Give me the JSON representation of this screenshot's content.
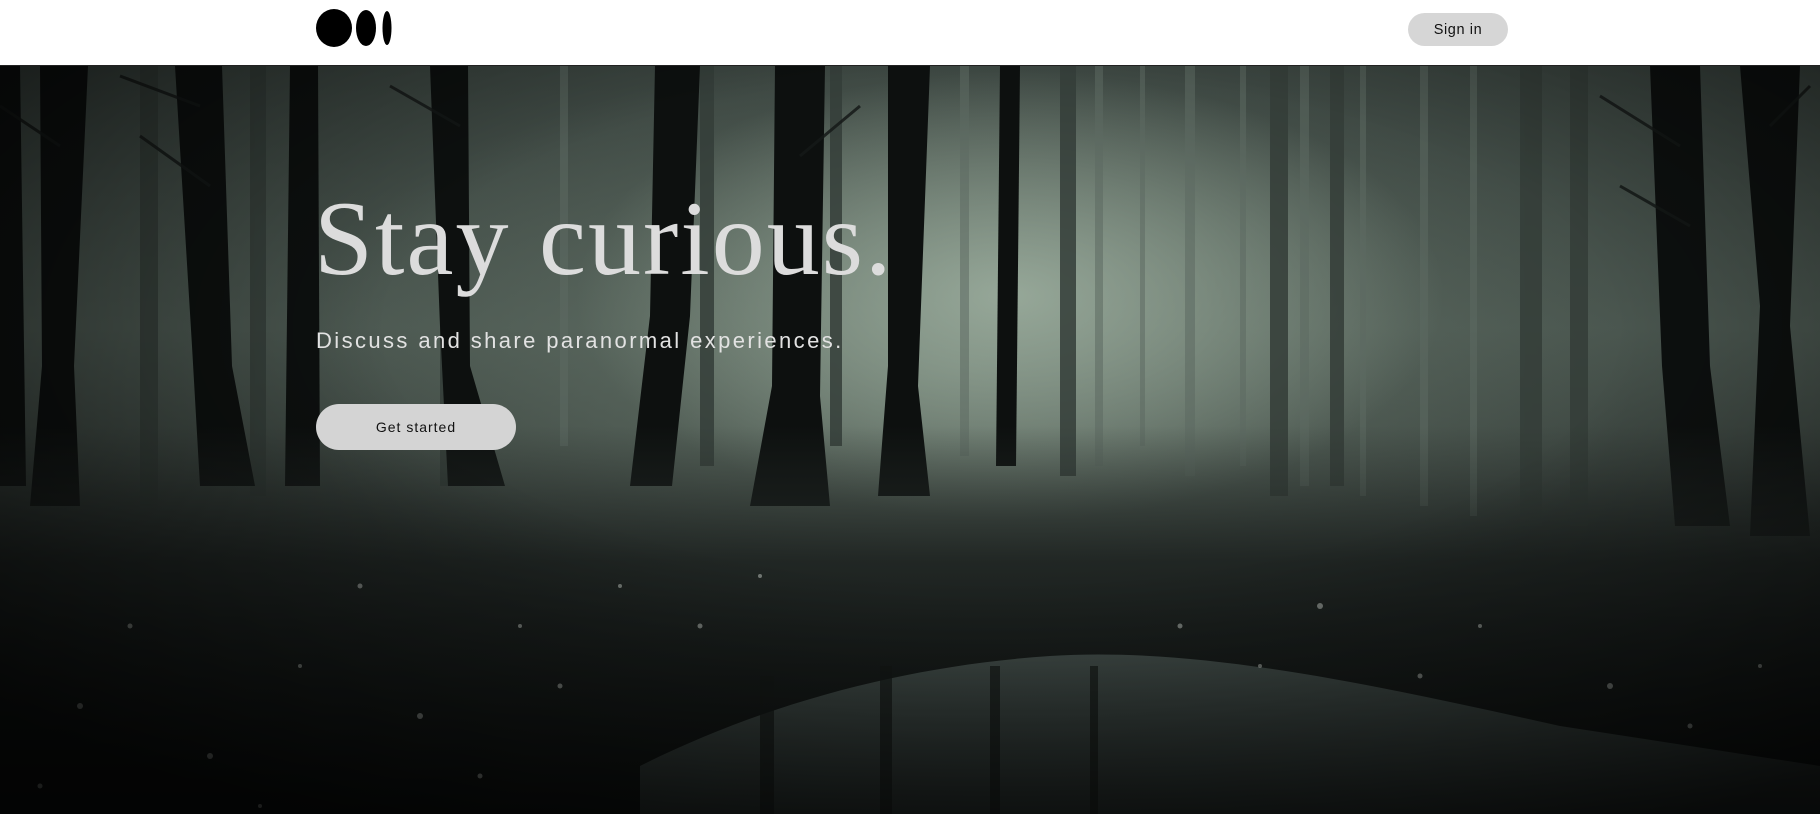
{
  "nav": {
    "logo_icon": "medium-logo-icon",
    "signin_label": "Sign in"
  },
  "hero": {
    "headline": "Stay curious.",
    "subtitle": "Discuss and share paranormal experiences.",
    "cta_label": "Get started",
    "background": "foggy-forest-image"
  },
  "colors": {
    "nav_bg": "#ffffff",
    "button_bg": "#d6d6d6",
    "headline": "#dcdcdc",
    "fog": "#8fa092"
  }
}
